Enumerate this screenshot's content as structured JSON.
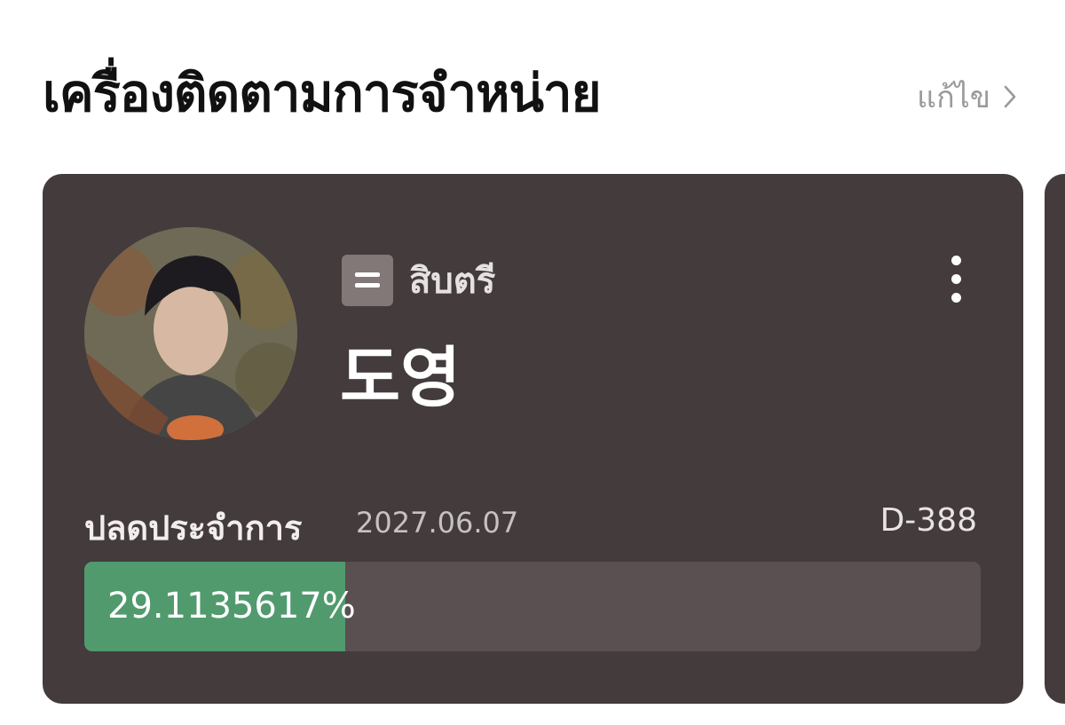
{
  "header": {
    "title": "เครื่องติดตามการจำหน่าย",
    "edit_label": "แก้ไข",
    "edit_icon": "chevron-right-icon"
  },
  "card": {
    "avatar": "avatar-photo",
    "rank_icon": "rank-insignia-icon",
    "rank": "สิบตรี",
    "name": "도영",
    "menu_icon": "more-vertical-icon",
    "discharge_label": "ปลดประจำการ",
    "discharge_date": "2027.06.07",
    "dday": "D-388",
    "progress_text": "29.1135617%",
    "progress_value": 29.1135617
  },
  "colors": {
    "card_bg": "#433b3c",
    "progress_fill": "#519a6e",
    "progress_track": "#5a5051"
  }
}
